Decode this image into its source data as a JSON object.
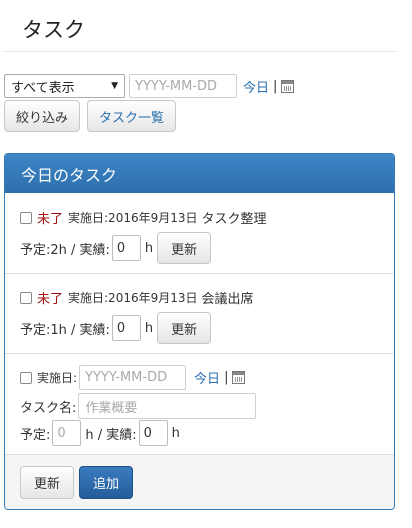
{
  "page": {
    "title": "タスク"
  },
  "filter": {
    "select_value": "すべて表示",
    "date_placeholder": "YYYY-MM-DD",
    "today_link": "今日",
    "separator": "|",
    "calendar_icon": "calendar-icon",
    "filter_button": "絞り込み",
    "task_list_button": "タスク一覧"
  },
  "panel": {
    "heading": "今日のタスク",
    "tasks": [
      {
        "status": "未了",
        "date_label": "実施日:2016年9月13日",
        "name": "タスク整理",
        "planned_label": "予定:2h / 実績:",
        "actual_value": "0",
        "unit": "h",
        "update_button": "更新"
      },
      {
        "status": "未了",
        "date_label": "実施日:2016年9月13日",
        "name": "会議出席",
        "planned_label": "予定:1h / 実績:",
        "actual_value": "0",
        "unit": "h",
        "update_button": "更新"
      }
    ],
    "new_task": {
      "date_label": "実施日:",
      "date_placeholder": "YYYY-MM-DD",
      "today_link": "今日",
      "separator": "|",
      "name_label": "タスク名:",
      "name_placeholder": "作業概要",
      "planned_label": "予定:",
      "planned_placeholder": "0",
      "unit_separator": "h / 実績:",
      "actual_value": "0",
      "unit": "h"
    },
    "footer": {
      "update_button": "更新",
      "add_button": "追加"
    }
  }
}
